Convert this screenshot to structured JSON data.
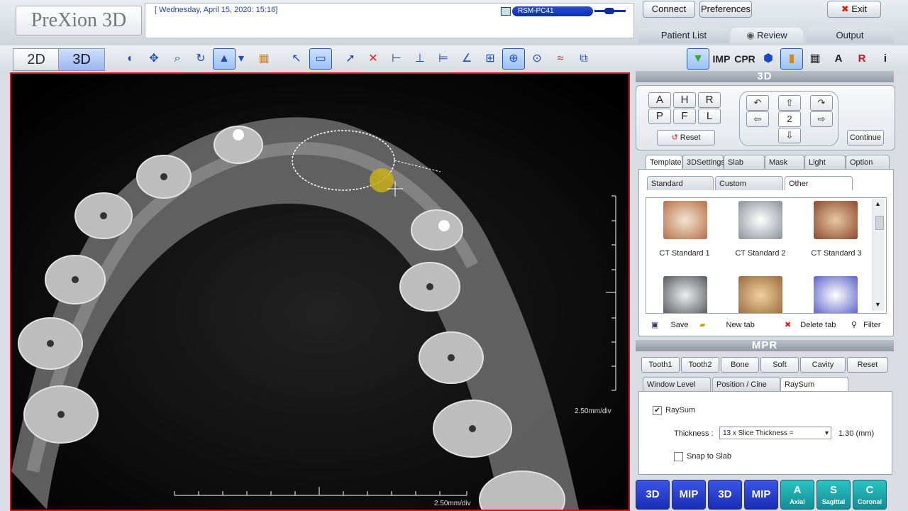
{
  "app": {
    "logo": "PreXion 3D",
    "date": "[ Wednesday, April 15, 2020: 15:16]",
    "pc_name": "RSM-PC41"
  },
  "header": {
    "connect": "Connect",
    "preferences": "Preferences",
    "exit": "Exit",
    "exit_icon": "✖"
  },
  "nav_tabs": [
    {
      "label": "Patient List"
    },
    {
      "label": "Review"
    },
    {
      "label": "Output"
    }
  ],
  "mode": {
    "btn_2d": "2D",
    "btn_3d": "3D"
  },
  "viewport": {
    "scale_right": "2.50mm/div",
    "scale_bottom": "2.50mm/div"
  },
  "right_tools": {
    "imp": "IMP",
    "cpr": "CPR",
    "a": "A",
    "r": "R",
    "i": "i"
  },
  "panel3d": {
    "title": "3D",
    "orient": [
      "A",
      "H",
      "R",
      "P",
      "F",
      "L"
    ],
    "reset": "Reset",
    "step": "2",
    "continue": "Continue",
    "tabs": [
      "Template",
      "3DSettings",
      "Slab",
      "Mask",
      "Light",
      "Option"
    ],
    "subtabs": [
      "Standard",
      "Custom",
      "Other"
    ],
    "thumbs": [
      {
        "label": "CT Standard 1"
      },
      {
        "label": "CT Standard 2"
      },
      {
        "label": "CT Standard 3"
      }
    ],
    "actions": {
      "save": "Save",
      "new_tab": "New tab",
      "delete_tab": "Delete tab",
      "filter": "Filter"
    }
  },
  "mpr": {
    "title": "MPR",
    "presets": [
      "Tooth1",
      "Tooth2",
      "Bone",
      "Soft",
      "Cavity",
      "Reset"
    ],
    "tabs": [
      "Window Level",
      "Position / Cine",
      "RaySum"
    ],
    "raysum_label": "RaySum",
    "raysum_check": "✔",
    "thickness_label": "Thickness :",
    "thickness_value": "13 x Slice Thickness =",
    "thickness_mm": "1.30 (mm)",
    "snap_label": "Snap to Slab"
  },
  "bottom": [
    {
      "label": "3D",
      "sub": ""
    },
    {
      "label": "MIP",
      "sub": ""
    },
    {
      "label": "3D",
      "sub": ""
    },
    {
      "label": "MIP",
      "sub": ""
    },
    {
      "label": "A",
      "sub": "Axial"
    },
    {
      "label": "S",
      "sub": "Sagittal"
    },
    {
      "label": "C",
      "sub": "Coronal"
    }
  ]
}
